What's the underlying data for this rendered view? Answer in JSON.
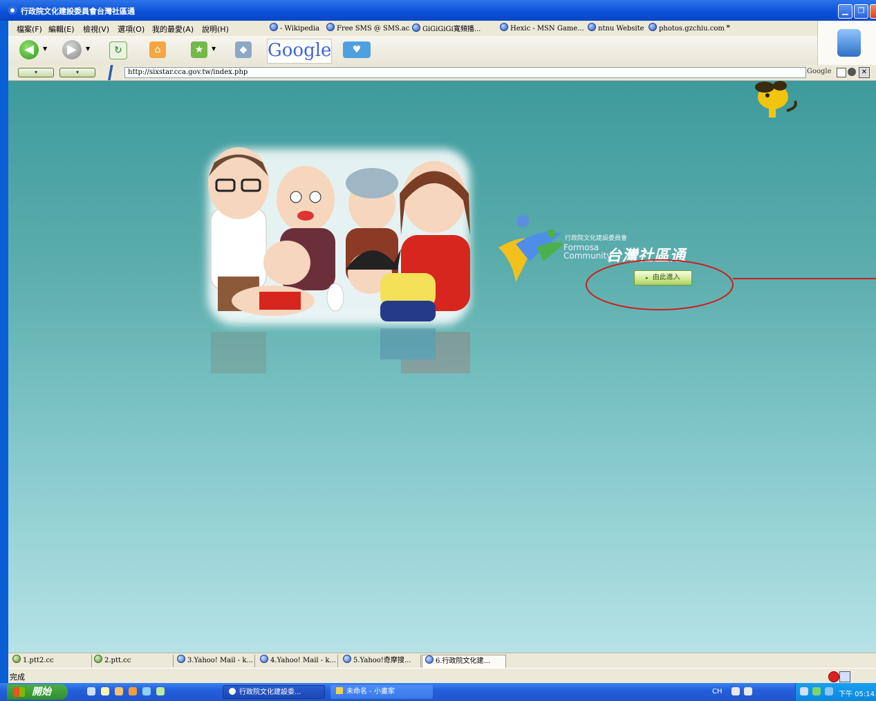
{
  "window": {
    "title": "行政院文化建設委員會台灣社區通"
  },
  "menubar": {
    "items": [
      "檔案(F)",
      "編輯(E)",
      "檢視(V)",
      "選項(O)",
      "我的最愛(A)",
      "說明(H)"
    ]
  },
  "links": {
    "items": [
      "- Wikipedia",
      "Free SMS @ SMS.ac",
      "GiGiGiGi寬頻播...",
      "Hexic - MSN Game...",
      "ntnu Website",
      "photos.gzchiu.com",
      "»"
    ]
  },
  "toolbar": {
    "google_label": "Google"
  },
  "address": {
    "url": "http://sixstar.cca.gov.tw/index.php",
    "google_label": "Google"
  },
  "content": {
    "org_name": "行政院文化建設委員會",
    "formosa": "Formosa",
    "community": "Community",
    "brand_name": "台灣社區通",
    "enter_button": "由此進入"
  },
  "tabs": {
    "items": [
      "1.ptt2.cc",
      "2.ptt.cc",
      "3.Yahoo! Mail - k...",
      "4.Yahoo! Mail - k...",
      "5.Yahoo!奇摩搜...",
      "6.行政院文化建..."
    ]
  },
  "status": {
    "text": "完成"
  },
  "taskbar": {
    "start_label": "開始",
    "tasks": [
      "行政院文化建設委...",
      "未命名 - 小畫家"
    ],
    "ime_label": "CH",
    "clock": "下午 05:14"
  },
  "colors": {
    "title_blue": "#0b50d8",
    "content_teal": "#3e9a9c",
    "annotation_red": "#cc1f1f",
    "enter_green": "#a9cf5c"
  }
}
